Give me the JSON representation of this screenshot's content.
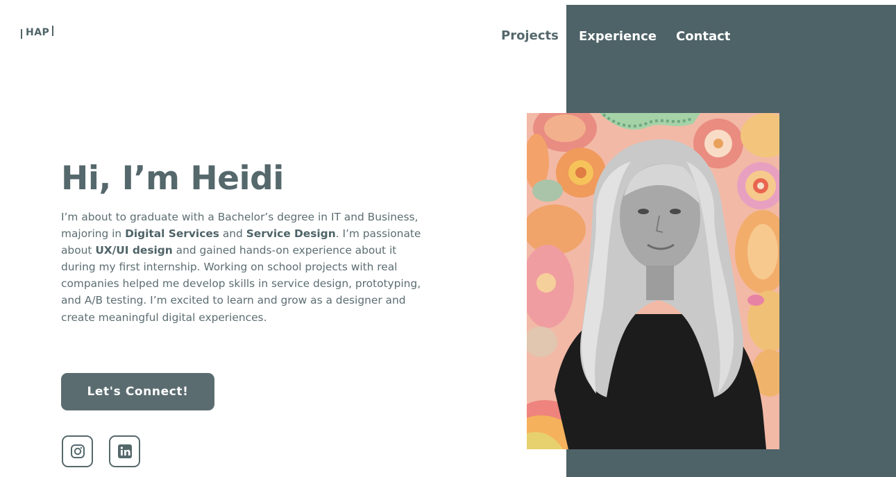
{
  "logo": {
    "text": "HAP"
  },
  "nav": {
    "projects": "Projects",
    "experience": "Experience",
    "contact": "Contact"
  },
  "hero": {
    "headline": "Hi, I’m Heidi",
    "bio": {
      "p1": "I’m about to graduate with a Bachelor’s degree in IT and Business, majoring in ",
      "b1": "Digital Services",
      "p2": " and ",
      "b2": "Service Design",
      "p3": ". I’m passionate about ",
      "b3": "UX/UI design",
      "p4": " and gained hands-on experience about it during my first internship. Working on school projects with real companies helped me develop skills in service design, prototyping, and A/B testing. I’m excited to learn and grow as a designer and create meaningful digital experiences."
    },
    "cta_label": "Let's Connect!"
  },
  "social": [
    {
      "icon": "instagram-icon"
    },
    {
      "icon": "linkedin-icon"
    }
  ],
  "colors": {
    "panel": "#4e6367",
    "text": "#55686c",
    "button": "#5b6c70",
    "photo_background": "#f2b7a4"
  }
}
